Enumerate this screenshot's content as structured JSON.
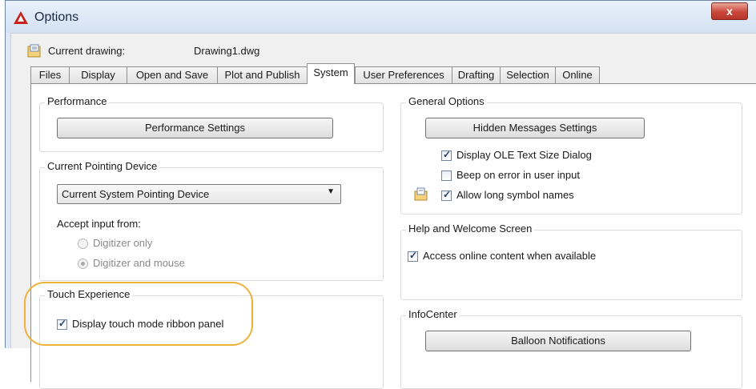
{
  "window": {
    "title": "Options",
    "close_glyph": "x"
  },
  "current_drawing": {
    "label": "Current drawing:",
    "value": "Drawing1.dwg"
  },
  "tabs": [
    {
      "label": "Files",
      "active": false
    },
    {
      "label": "Display",
      "active": false
    },
    {
      "label": "Open and Save",
      "active": false
    },
    {
      "label": "Plot and Publish",
      "active": false
    },
    {
      "label": "System",
      "active": true
    },
    {
      "label": "User Preferences",
      "active": false
    },
    {
      "label": "Drafting",
      "active": false
    },
    {
      "label": "Selection",
      "active": false
    },
    {
      "label": "Online",
      "active": false
    }
  ],
  "performance": {
    "title": "Performance",
    "button": "Performance Settings"
  },
  "pointing_device": {
    "title": "Current Pointing Device",
    "selected": "Current System Pointing Device",
    "accept_label": "Accept input from:",
    "options": [
      {
        "label": "Digitizer only",
        "selected": false,
        "enabled": false
      },
      {
        "label": "Digitizer and mouse",
        "selected": true,
        "enabled": false
      }
    ]
  },
  "touch": {
    "title": "Touch Experience",
    "checkbox": {
      "label": "Display touch mode ribbon panel",
      "checked": true
    }
  },
  "general": {
    "title": "General Options",
    "button": "Hidden Messages Settings",
    "checkboxes": [
      {
        "label": "Display OLE Text Size Dialog",
        "checked": true
      },
      {
        "label": "Beep on error in user input",
        "checked": false
      },
      {
        "label": "Allow long symbol names",
        "checked": true
      }
    ]
  },
  "help": {
    "title": "Help and Welcome Screen",
    "checkbox": {
      "label": "Access online content when available",
      "checked": true
    }
  },
  "infocenter": {
    "title": "InfoCenter",
    "button": "Balloon Notifications"
  },
  "colors": {
    "highlight": "#eeb13a",
    "title_bar": "#dfe9f5",
    "close_button": "#c9483a"
  },
  "glyphs": {
    "check": "✓",
    "dropdown": "▼"
  }
}
